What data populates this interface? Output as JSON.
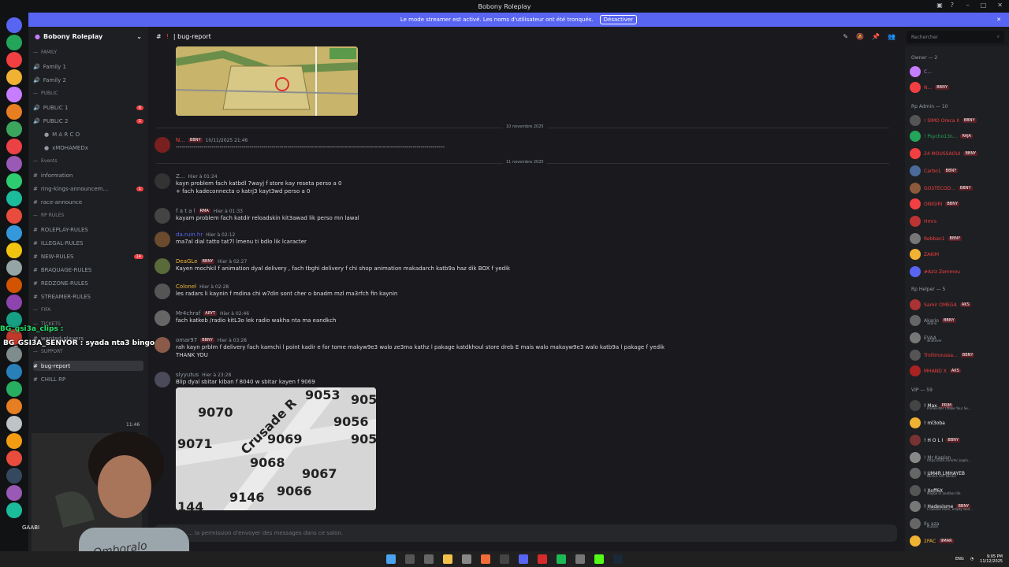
{
  "window": {
    "title": "Bobony Roleplay"
  },
  "banner": {
    "text": "Le mode streamer est activé. Les noms d'utilisateur ont été tronqués.",
    "button": "Désactiver"
  },
  "server": {
    "name": "Bobony Roleplay"
  },
  "channels": [
    {
      "label": "FAMILY",
      "type": "cat"
    },
    {
      "label": "Family 1",
      "type": "voice"
    },
    {
      "label": "Family 2",
      "type": "voice"
    },
    {
      "label": "PUBLIC",
      "type": "cat"
    },
    {
      "label": "PUBLIC 1",
      "type": "voice",
      "badge": "6"
    },
    {
      "label": "PUBLIC 2",
      "type": "voice",
      "badge": "1"
    },
    {
      "label": "M A R C O",
      "type": "user"
    },
    {
      "label": "xMOHAMEDx",
      "type": "user"
    },
    {
      "label": "Events",
      "type": "cat"
    },
    {
      "label": "information",
      "type": "text"
    },
    {
      "label": "ring-kings-announcem...",
      "type": "text",
      "badge": "1"
    },
    {
      "label": "race-announce",
      "type": "text"
    },
    {
      "label": "RP RULES",
      "type": "cat"
    },
    {
      "label": "ROLEPLAY-RULES",
      "type": "text"
    },
    {
      "label": "ILLEGAL-RULES",
      "type": "text"
    },
    {
      "label": "NEW-RULES",
      "type": "text",
      "badge": "14"
    },
    {
      "label": "BRAQUAGE-RULES",
      "type": "text"
    },
    {
      "label": "REDZONE-RULES",
      "type": "text"
    },
    {
      "label": "STREAMER-RULES",
      "type": "text"
    },
    {
      "label": "FIFA",
      "type": "cat"
    },
    {
      "label": "TICKETS",
      "type": "cat"
    },
    {
      "label": "wanted-players",
      "type": "text"
    },
    {
      "label": "SUPPORT",
      "type": "cat"
    },
    {
      "label": "bug-report",
      "type": "text",
      "active": true
    },
    {
      "label": "CHILL RP",
      "type": "text"
    }
  ],
  "topbar": {
    "channel": "| bug-report",
    "search_placeholder": "Rechercher"
  },
  "dividers": [
    "10 novembre 2025",
    "11 novembre 2025"
  ],
  "messages": [
    {
      "name": "N...",
      "tag": "BBNY",
      "time": "10/11/2025 21:46",
      "text": "---------------------------------------------------------------------------------------------------------------------------------------",
      "color": "#f23f42"
    },
    {
      "name": "Z...",
      "tag": "",
      "time": "Hier à 01:24",
      "text": "kayn problem fach katbdl 7wayj f store kay reseta perso a 0",
      "text2": "+ fach kadeconnecta o katrj3 kayt3wd perso a 0",
      "color": "#949ba4"
    },
    {
      "name": "f a t a l",
      "tag": "RMA",
      "time": "Hier à 01:33",
      "text": "kayam problem fach katdir reloadskin kit3awad lik perso mn lawal",
      "color": "#949ba4"
    },
    {
      "name": "da.ruin.hr",
      "tag": "",
      "time": "Hier à 02:12",
      "text": "ma7al dial tatto tat7l lmenu ti bdlo lik lcaracter",
      "color": "#5865f2"
    },
    {
      "name": "DeaGLe",
      "tag": "BBNY",
      "time": "Hier à 02:27",
      "text": "Kayen mochkil f animation dyal delivery , fach tbghi delivery f chi shop animation makadarch katb9a haz dik BOX f yedik",
      "color": "#f0b232"
    },
    {
      "name": "Colonel",
      "tag": "",
      "time": "Hier à 02:28",
      "text": "les radars li kaynin f mdina chi w7din sont cher o bnadm mzl ma3rfch fin kaynin",
      "color": "#f0b232"
    },
    {
      "name": "Mr4chraf",
      "tag": "ARYT",
      "time": "Hier à 02:46",
      "text": "fach katkeb /radio kitL3o lek radio wakha nta ma eandkch",
      "color": "#949ba4"
    },
    {
      "name": "omar97",
      "tag": "BBNY",
      "time": "Hier à 03:28",
      "text": "rah kayn prblm f delivery fach kamchi l point kadir e for tome makyw9e3 walo ze3ma kathz l pakage katdkhoul store dreb E mais walo makayw9e3 walo katb9a l pakage f yedik",
      "text2": "THANK YOU",
      "color": "#949ba4"
    },
    {
      "name": "slyyutus",
      "tag": "",
      "time": "Hier à 23:28",
      "text": "Blip dyal sbitar kiban f 8040 w sbitar kayen f 9069",
      "color": "#949ba4"
    }
  ],
  "zoom_map_numbers": [
    "9053",
    "9070",
    "905",
    "Crusade R",
    "9056",
    "9071",
    "9069",
    "905",
    "9068",
    "9067",
    "9146",
    "9066",
    "144"
  ],
  "composer": {
    "placeholder": "... la permission d'envoyer des messages dans ce salon."
  },
  "members": {
    "groups": [
      "Owner — 2",
      "Rp Admin — 10",
      "Rp Helper — 5",
      "VIP — 59"
    ],
    "list": [
      {
        "name": "C...",
        "color": "#c77dff",
        "group": 0
      },
      {
        "name": "N...",
        "tag": "BBNY",
        "color": "#f23f42",
        "group": 0
      },
      {
        "name": "! SIMO Oreca II",
        "tag": "BBNY",
        "color": "#f23f42",
        "group": 1
      },
      {
        "name": "! Psycho13n...",
        "tag": "RAJA",
        "color": "#23a55a",
        "group": 1
      },
      {
        "name": "24 MOUSSAOUI",
        "tag": "BBNY",
        "color": "#f23f42",
        "group": 1
      },
      {
        "name": "Carbo1",
        "tag": "BBNY",
        "color": "#f23f42",
        "group": 1
      },
      {
        "name": "GOSTECOD...",
        "tag": "BBNY",
        "color": "#f23f42",
        "group": 1
      },
      {
        "name": "ONIGIRI",
        "tag": "BBNY",
        "color": "#f23f42",
        "group": 1
      },
      {
        "name": "Hmrs",
        "color": "#f23f42",
        "group": 1
      },
      {
        "name": "Rebban1",
        "tag": "BBNY",
        "color": "#f23f42",
        "group": 1
      },
      {
        "name": "ZAKIM",
        "color": "#f23f42",
        "group": 1
      },
      {
        "name": "#Aziz Zemmou",
        "color": "#f23f42",
        "group": 1
      },
      {
        "name": "Samir OMEGA",
        "tag": "AKS",
        "color": "#f23f42",
        "group": 2
      },
      {
        "name": "Akario",
        "tag": "BBNY",
        "color": "#949ba4",
        "group": 2,
        "sub": "akario"
      },
      {
        "name": "EVAA",
        "color": "#949ba4",
        "group": 2,
        "sub": "whatever"
      },
      {
        "name": "Trollimoussa...",
        "tag": "BBNY",
        "color": "#f23f42",
        "group": 2
      },
      {
        "name": "MHAND X",
        "tag": "AKS",
        "color": "#f23f42",
        "group": 2
      },
      {
        "name": "! Max",
        "tag": "PRIM",
        "color": "#f2f3f5",
        "group": 3,
        "sub": "PrimeFilter I Make Your Se..."
      },
      {
        "name": "! ml3oba",
        "color": "#f2f3f5",
        "group": 3
      },
      {
        "name": "! H O L I",
        "tag": "BBNY",
        "color": "#f2f3f5",
        "group": 3
      },
      {
        "name": "! Mr Kaplan",
        "color": "#949ba4",
        "group": 3,
        "sub": "https://kick.com/mr_kapla..."
      },
      {
        "name": "! UM4R LMHAYEB",
        "color": "#f2f3f5",
        "group": 3,
        "sub": "NEVER SAY NEVER"
      },
      {
        "name": "! Xoff6X",
        "color": "#f2f3f5",
        "group": 3,
        "sub": "Maybe in another life"
      },
      {
        "name": "! Hadesisme",
        "tag": "BBNY",
        "color": "#f2f3f5",
        "group": 3,
        "sub": "Crowded room, empty soul..."
      },
      {
        "name": "Ily aza",
        "color": "#949ba4",
        "group": 3,
        "sub": "illusion"
      },
      {
        "name": "2PAC",
        "tag": "9MAR",
        "color": "#f0b232",
        "group": 3
      }
    ]
  },
  "overlays": {
    "line1": "BG_gsi3a_clips :",
    "line2": "BG_GSI3A_SENYOR : syada nta3 bingo"
  },
  "webcam_shirt": "Omboralo",
  "user_panel": {
    "name": "GAABI",
    "time": "11:46"
  },
  "taskbar": {
    "lang": "ENG",
    "time": "9:05 PM",
    "date": "11/12/2025"
  }
}
